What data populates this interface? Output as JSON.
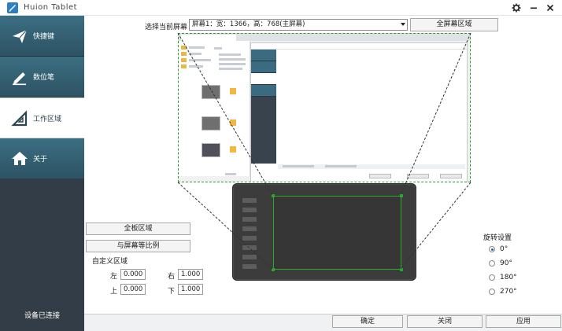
{
  "window": {
    "title": "Huion Tablet",
    "settings_icon": "gear-icon",
    "minimize_icon": "minimize-icon",
    "close_icon": "close-icon"
  },
  "sidebar": {
    "items": [
      {
        "label": "快捷键",
        "icon": "paper-plane-icon",
        "active": false
      },
      {
        "label": "数位笔",
        "icon": "pen-icon",
        "active": false
      },
      {
        "label": "工作区域",
        "icon": "triangle-ruler-icon",
        "active": true
      },
      {
        "label": "关于",
        "icon": "home-icon",
        "active": false
      }
    ],
    "status": "设备已连接"
  },
  "screen": {
    "label": "选择当前屏幕",
    "selected": "屏幕1：宽：1366，高：768(主屏幕)",
    "fullscreen_button": "全屏幕区域"
  },
  "area": {
    "full_tablet_button": "全板区域",
    "match_ratio_button": "与屏幕等比例",
    "custom_label": "自定义区域",
    "left_label": "左",
    "left_value": "0.000",
    "right_label": "右",
    "right_value": "1.000",
    "top_label": "上",
    "top_value": "0.000",
    "bottom_label": "下",
    "bottom_value": "1.000"
  },
  "rotation": {
    "title": "旋转设置",
    "options": [
      "0°",
      "90°",
      "180°",
      "270°"
    ],
    "selected": "0°"
  },
  "footer": {
    "ok_button": "确定",
    "close_button": "关闭",
    "apply_button": "应用"
  },
  "colors": {
    "accent": "#2d7fc4",
    "sidebar_item": "#3b6e82",
    "sidebar_bg": "#39434e",
    "mapping_frame": "#2aa82a"
  }
}
